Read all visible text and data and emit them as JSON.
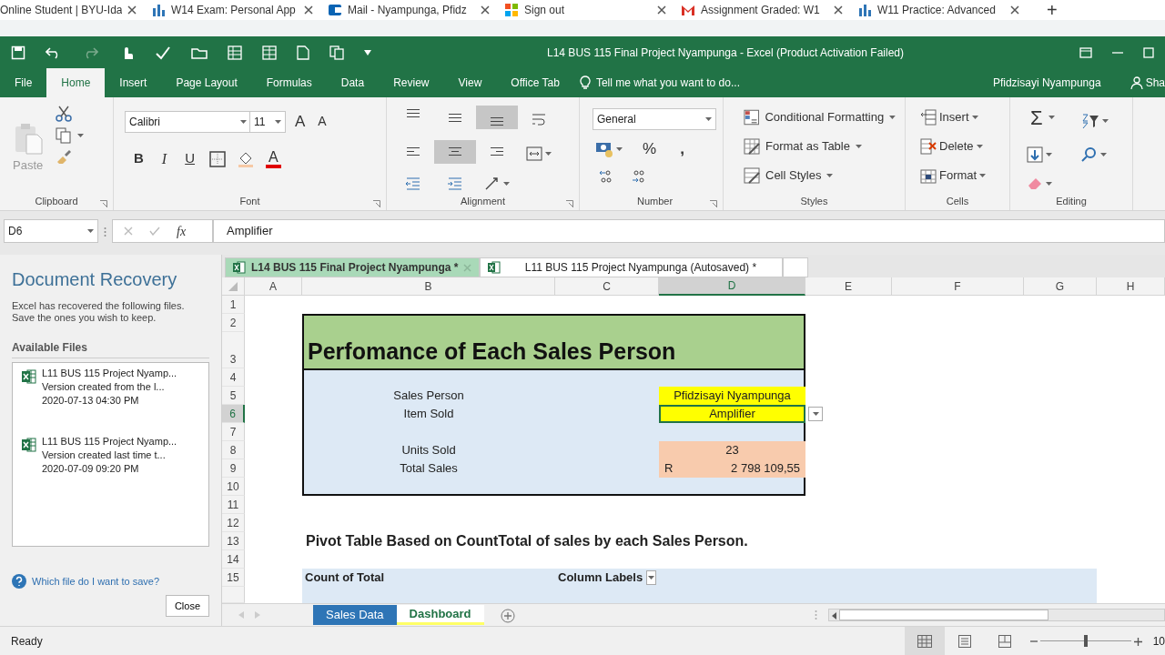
{
  "browser_tabs": [
    {
      "title": "Online Student | BYU-Ida",
      "kind": "none"
    },
    {
      "title": "W14 Exam: Personal App",
      "kind": "chart"
    },
    {
      "title": "Mail - Nyampunga, Pfidz",
      "kind": "mail"
    },
    {
      "title": "Sign out",
      "kind": "squares"
    },
    {
      "title": "Assignment Graded: W1",
      "kind": "gmail"
    },
    {
      "title": "W11 Practice: Advanced",
      "kind": "chart"
    }
  ],
  "new_tab": "+",
  "window": {
    "title": "L14 BUS 115 Final Project Nyampunga - Excel (Product Activation Failed)"
  },
  "ribbon_tabs": [
    {
      "label": "File",
      "selected": false
    },
    {
      "label": "Home",
      "selected": true
    },
    {
      "label": "Insert",
      "selected": false
    },
    {
      "label": "Page Layout",
      "selected": false
    },
    {
      "label": "Formulas",
      "selected": false
    },
    {
      "label": "Data",
      "selected": false
    },
    {
      "label": "Review",
      "selected": false
    },
    {
      "label": "View",
      "selected": false
    },
    {
      "label": "Office Tab",
      "selected": false
    }
  ],
  "tell_me": "Tell me what you want to do...",
  "user": "Pfidzisayi Nyampunga",
  "share": "Sha",
  "ribbon": {
    "clipboard": {
      "paste": "Paste",
      "label": "Clipboard"
    },
    "font": {
      "name": "Calibri",
      "size": "11",
      "grow": "A",
      "shrink": "A",
      "bold": "B",
      "italic": "I",
      "underline": "U",
      "font_color": "A",
      "label": "Font"
    },
    "alignment": {
      "buttons": [
        {
          "kind": "top",
          "pressed": false
        },
        {
          "kind": "middle",
          "pressed": false
        },
        {
          "kind": "bottom",
          "pressed": true
        },
        {
          "kind": "left",
          "pressed": false
        },
        {
          "kind": "center",
          "pressed": true
        },
        {
          "kind": "right",
          "pressed": false
        }
      ],
      "label": "Alignment"
    },
    "number": {
      "format": "General",
      "percent": "%",
      "comma": ",",
      "label": "Number"
    },
    "styles": {
      "items": [
        {
          "label": "Conditional Formatting",
          "kind": "conditional"
        },
        {
          "label": "Format as Table",
          "kind": "table"
        },
        {
          "label": "Cell Styles",
          "kind": "styles"
        }
      ],
      "label": "Styles"
    },
    "cells": {
      "items": [
        {
          "label": "Insert",
          "kind": "insert"
        },
        {
          "label": "Delete",
          "kind": "delete"
        },
        {
          "label": "Format",
          "kind": "format"
        }
      ],
      "label": "Cells"
    },
    "editing": {
      "sum": "Σ",
      "label": "Editing"
    }
  },
  "formula_bar": {
    "name_box": "D6",
    "function_label": "fx",
    "value": "Amplifier"
  },
  "recovery": {
    "title": "Document Recovery",
    "description": "Excel has recovered the following files. Save the ones you wish to keep.",
    "available_label": "Available Files",
    "files": [
      {
        "name": "L11 BUS 115 Project Nyamp...",
        "version": "Version created from the l...",
        "date": "2020-07-13 04:30 PM"
      },
      {
        "name": "L11 BUS 115 Project Nyamp...",
        "version": "Version created last time t...",
        "date": "2020-07-09 09:20 PM"
      }
    ],
    "help": "Which file do I want to save?",
    "close": "Close"
  },
  "doc_tabs": [
    {
      "title": "L14 BUS 115 Final Project Nyampunga *",
      "selected": true
    },
    {
      "title": "L11 BUS 115 Project Nyampunga (Autosaved) *",
      "selected": false
    }
  ],
  "sheet": {
    "columns": [
      {
        "label": "A",
        "selected": false
      },
      {
        "label": "B",
        "selected": false
      },
      {
        "label": "C",
        "selected": false
      },
      {
        "label": "D",
        "selected": true
      },
      {
        "label": "E",
        "selected": false
      },
      {
        "label": "F",
        "selected": false
      },
      {
        "label": "G",
        "selected": false
      },
      {
        "label": "H",
        "selected": false
      }
    ],
    "rows": [
      {
        "label": "1",
        "selected": false
      },
      {
        "label": "2",
        "selected": false
      },
      {
        "label": "3",
        "selected": false,
        "cells": {
          "B": {
            "kind": "title",
            "text": "Perfomance of Each Sales Person",
            "selected": false
          }
        }
      },
      {
        "label": "4",
        "selected": false
      },
      {
        "label": "5",
        "selected": false,
        "cells": {
          "B": {
            "kind": "label",
            "text": "Sales Person",
            "selected": false
          },
          "D": {
            "kind": "highlight",
            "text": "Pfidzisayi Nyampunga",
            "selected": false
          }
        }
      },
      {
        "label": "6",
        "selected": true,
        "cells": {
          "B": {
            "kind": "label",
            "text": "Item Sold",
            "selected": false
          },
          "D": {
            "kind": "highlight",
            "text": "Amplifier",
            "selected": true
          }
        }
      },
      {
        "label": "7",
        "selected": false
      },
      {
        "label": "8",
        "selected": false,
        "cells": {
          "B": {
            "kind": "label",
            "text": "Units Sold",
            "selected": false
          },
          "D": {
            "kind": "number",
            "text": "23",
            "selected": false
          }
        }
      },
      {
        "label": "9",
        "selected": false,
        "cells": {
          "B": {
            "kind": "label",
            "text": "Total Sales",
            "selected": false
          },
          "D": {
            "kind": "amount",
            "currency": "R",
            "text": "2 798 109,55",
            "selected": false
          }
        }
      },
      {
        "label": "10",
        "selected": false
      },
      {
        "label": "11",
        "selected": false
      },
      {
        "label": "12",
        "selected": false
      },
      {
        "label": "13",
        "selected": false,
        "cells": {
          "B": {
            "kind": "heading",
            "text": "Pivot Table Based on CountTotal of sales by each Sales Person.",
            "selected": false
          }
        }
      },
      {
        "label": "14",
        "selected": false
      },
      {
        "label": "15",
        "selected": false,
        "cells": {
          "B": {
            "kind": "pivot",
            "text": "Count of Total",
            "selected": false
          },
          "C": {
            "kind": "pivot_filter",
            "text": "Column Labels",
            "selected": false
          }
        }
      }
    ]
  },
  "sheet_tabs": [
    {
      "name": "Sales Data",
      "selected": false,
      "color": "#2e75b6"
    },
    {
      "name": "Dashboard",
      "selected": true,
      "color": "#ffff66"
    }
  ],
  "status": {
    "text": "Ready",
    "level": 0.5,
    "zoom": "10"
  }
}
